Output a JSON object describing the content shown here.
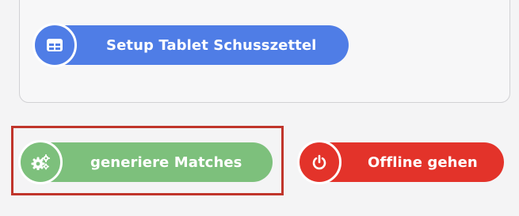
{
  "buttons": {
    "setup_tablet": {
      "label": "Setup Tablet Schusszettel",
      "icon": "table-icon",
      "color": "#4f7de6"
    },
    "generate_matches": {
      "label": "generiere Matches",
      "icon": "cogs-icon",
      "color": "#7dc07c"
    },
    "go_offline": {
      "label": "Offline gehen",
      "icon": "power-icon",
      "color": "#e3332a"
    }
  },
  "highlight": {
    "target": "generate_matches",
    "color": "#c0352b"
  },
  "colors": {
    "background": "#f4f4f5",
    "card_border": "#d1d1d4"
  }
}
